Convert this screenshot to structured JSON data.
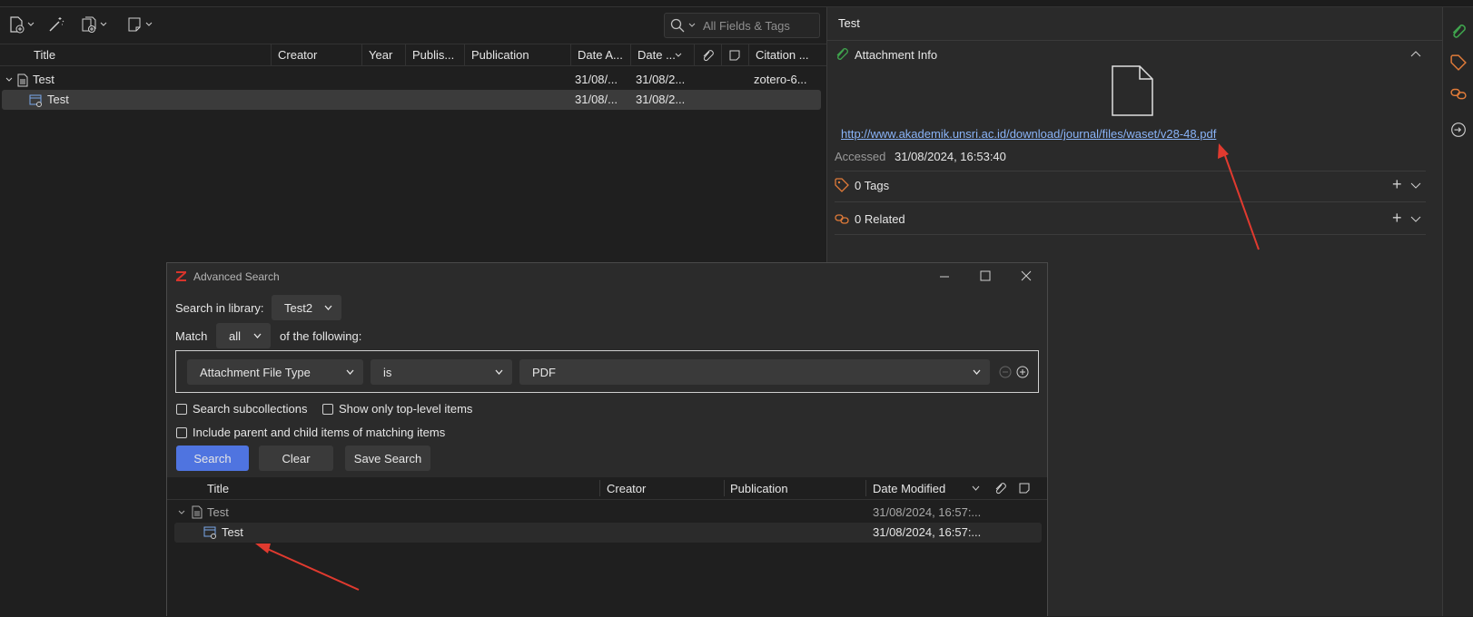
{
  "toolbar": {
    "search_placeholder": "All Fields & Tags"
  },
  "main_table": {
    "columns": [
      "Title",
      "Creator",
      "Year",
      "Publis...",
      "Publication",
      "Date A...",
      "Date ...",
      "Citation ..."
    ],
    "rows": [
      {
        "title": "Test",
        "date_added": "31/08/...",
        "date_modified": "31/08/2...",
        "citation": "zotero-6..."
      },
      {
        "title": "Test",
        "date_added": "31/08/...",
        "date_modified": "31/08/2...",
        "citation": ""
      }
    ]
  },
  "item_pane": {
    "title": "Test",
    "attachment_info_label": "Attachment Info",
    "url": "http://www.akademik.unsri.ac.id/download/journal/files/waset/v28-48.pdf",
    "accessed_label": "Accessed",
    "accessed_value": "31/08/2024, 16:53:40",
    "tags_label": "0 Tags",
    "related_label": "0 Related"
  },
  "dialog": {
    "title": "Advanced Search",
    "search_in_library_label": "Search in library:",
    "library_value": "Test2",
    "match_label": "Match",
    "match_value": "all",
    "following_label": "of the following:",
    "condition_field": "Attachment File Type",
    "condition_operator": "is",
    "condition_value": "PDF",
    "chk_subcollections": "Search subcollections",
    "chk_top_level": "Show only top-level items",
    "chk_parent_child": "Include parent and child items of matching items",
    "btn_search": "Search",
    "btn_clear": "Clear",
    "btn_save": "Save Search",
    "result_columns": [
      "Title",
      "Creator",
      "Publication",
      "Date Modified"
    ],
    "result_rows": [
      {
        "title": "Test",
        "date_modified": "31/08/2024, 16:57:..."
      },
      {
        "title": "Test",
        "date_modified": "31/08/2024, 16:57:..."
      }
    ]
  },
  "colors": {
    "accent_button": "#4f74e0",
    "link": "#8ab4f8",
    "arrow": "#e03a2f",
    "green_icon": "#3fa34d",
    "orange_icon": "#e07b39"
  }
}
